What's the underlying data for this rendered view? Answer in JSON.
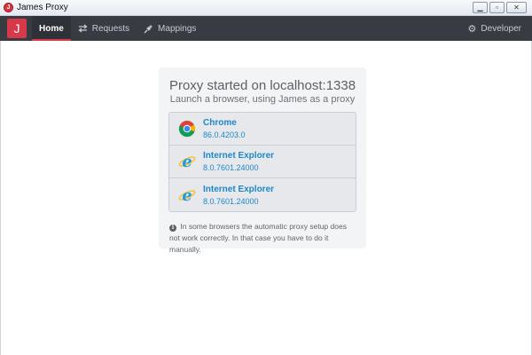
{
  "window": {
    "title": "James Proxy",
    "app_icon_letter": "J",
    "controls": {
      "minimize": "▁",
      "maximize": "▫",
      "close": "✕"
    }
  },
  "navbar": {
    "brand_letter": "J",
    "brand_color": "#d63a49",
    "items": [
      {
        "label": "Home",
        "icon": "home",
        "active": true
      },
      {
        "label": "Requests",
        "icon": "exchange-arrows-icon",
        "active": false
      },
      {
        "label": "Mappings",
        "icon": "plug-icon",
        "active": false
      }
    ],
    "right_item": {
      "label": "Developer",
      "icon": "gear-icon"
    }
  },
  "main": {
    "title": "Proxy started on localhost:1338",
    "subtitle": "Launch a browser, using James as a proxy",
    "browsers": [
      {
        "name": "Chrome",
        "version": "86.0.4203.0",
        "icon": "chrome-icon"
      },
      {
        "name": "Internet Explorer",
        "version": "8.0.7601.24000",
        "icon": "internet-explorer-icon"
      },
      {
        "name": "Internet Explorer",
        "version": "8.0.7601.24000",
        "icon": "internet-explorer-icon"
      }
    ],
    "notice": "In some browsers the automatic proxy setup does not work correctly. In that case you have to do it manually."
  },
  "colors": {
    "navbar_bg": "#383b42",
    "accent": "#d63a49",
    "link": "#1e88c7"
  }
}
